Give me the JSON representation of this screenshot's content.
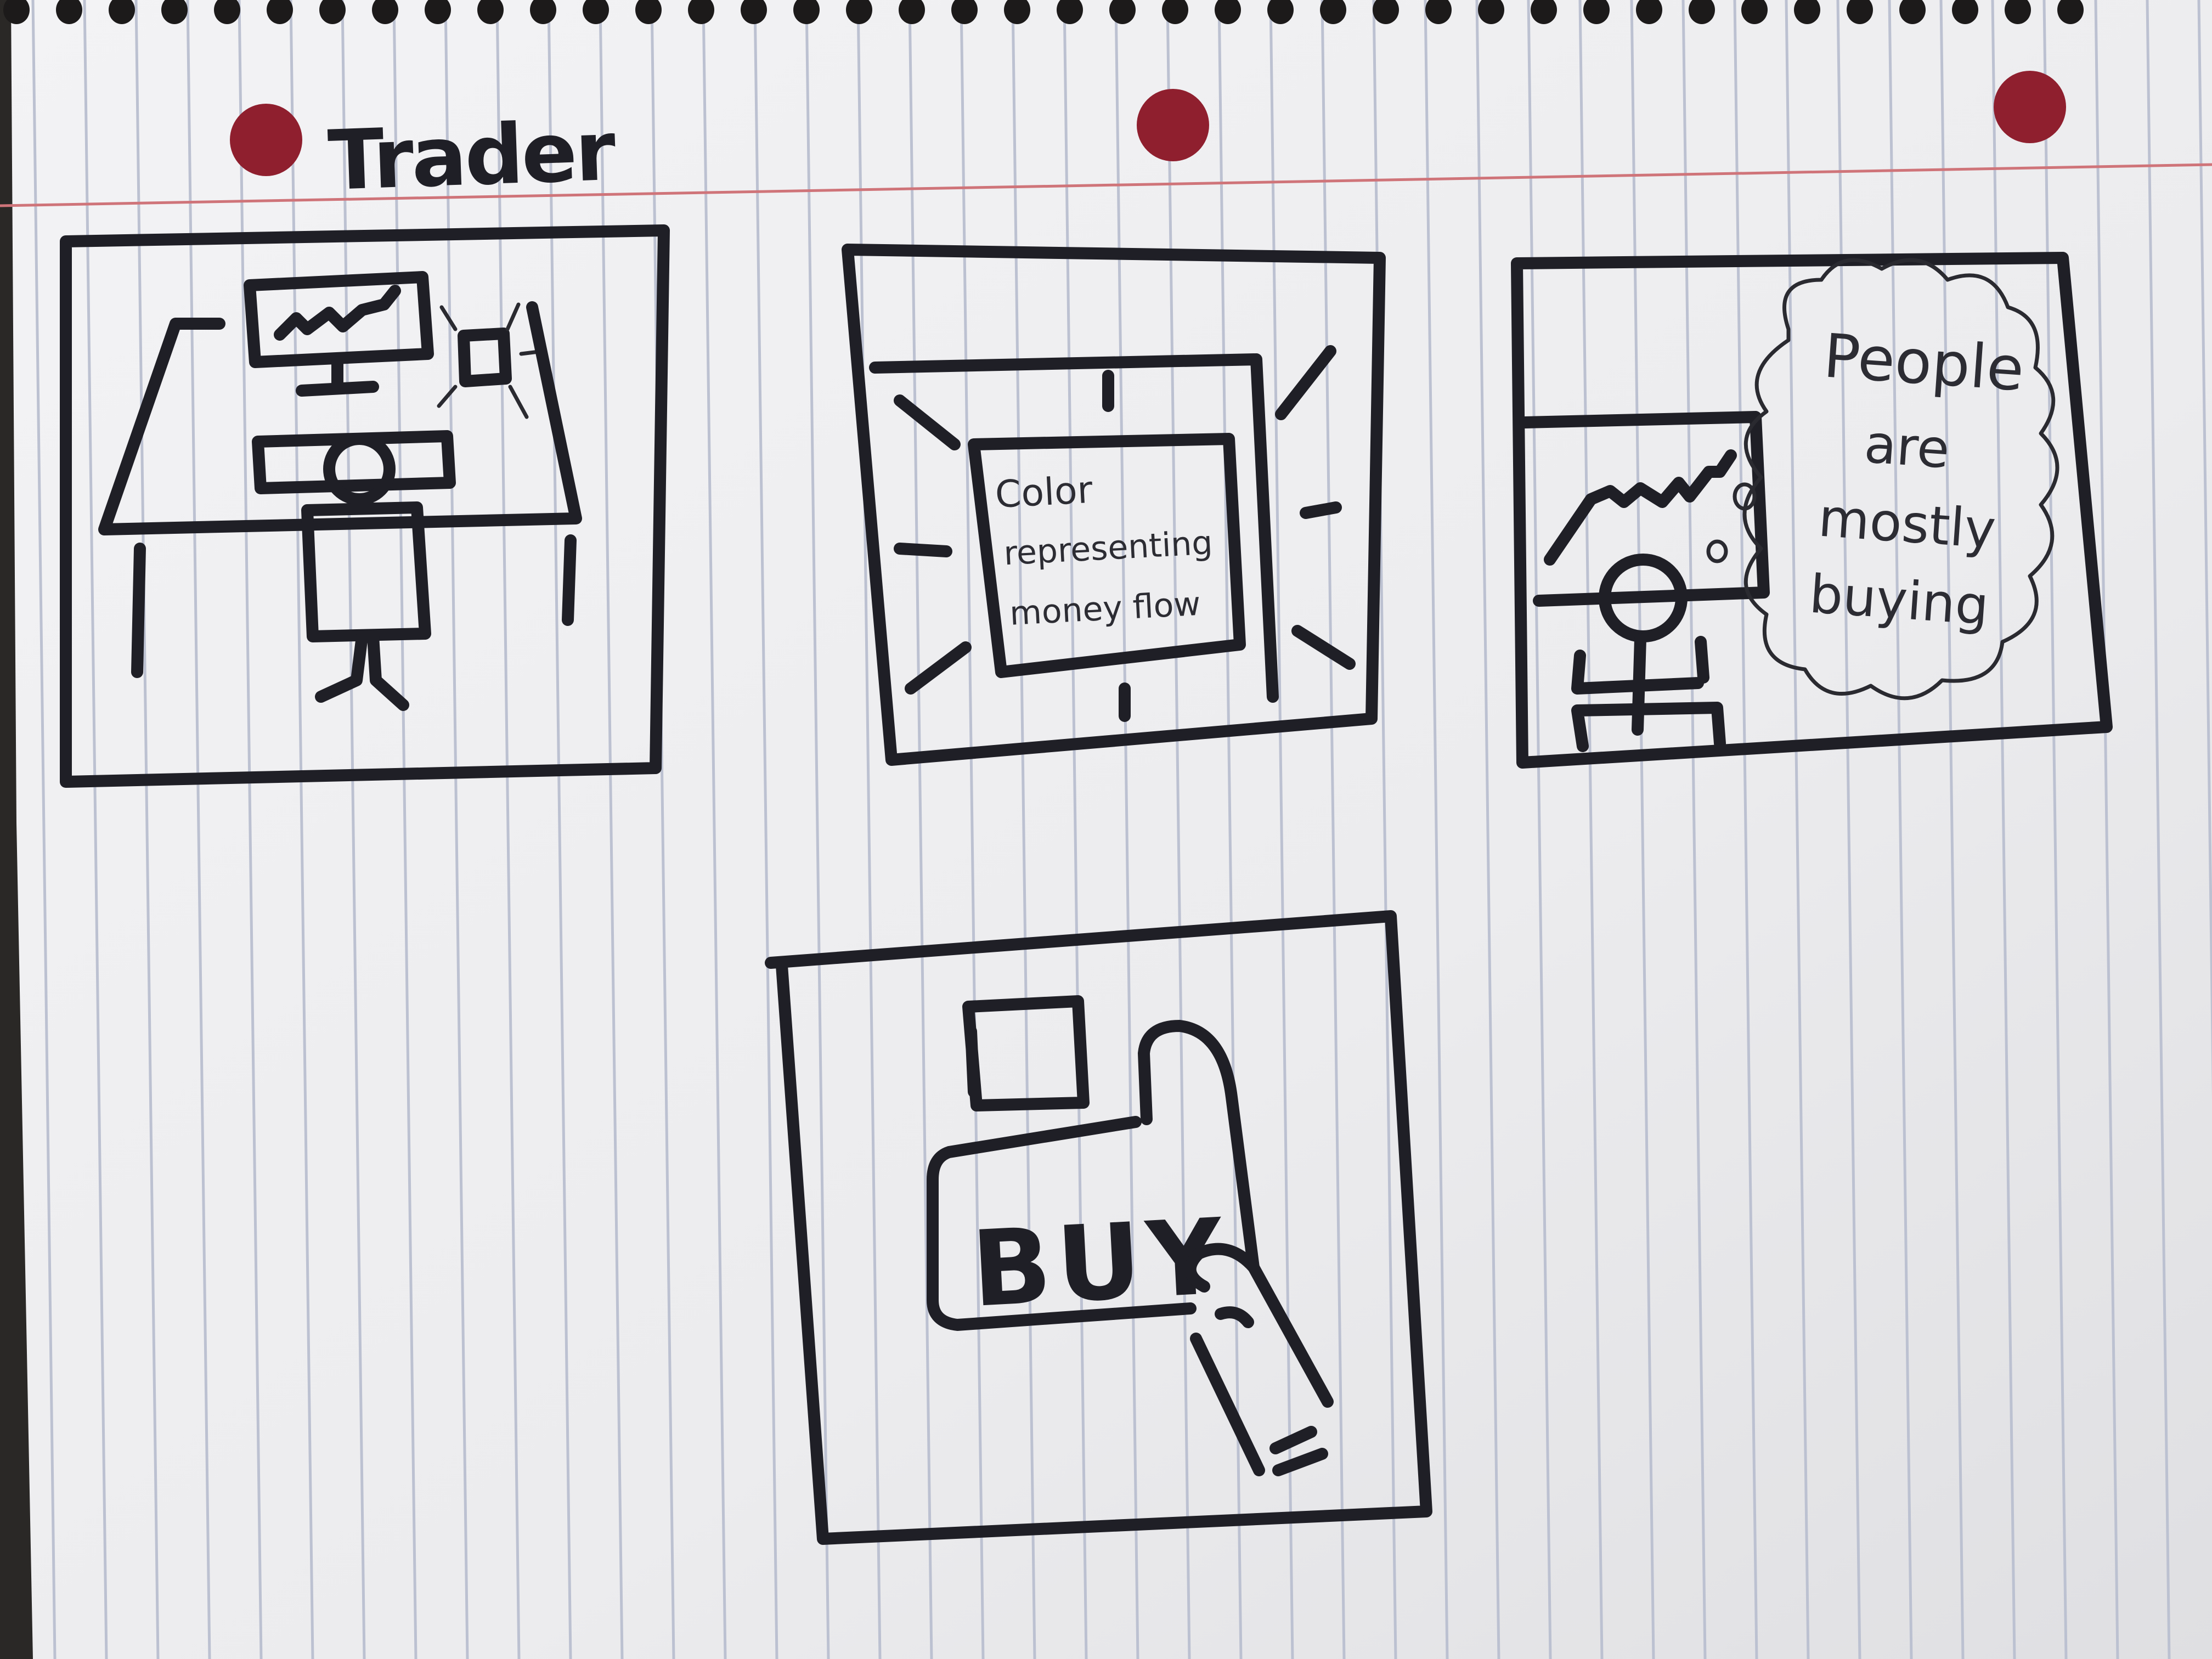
{
  "page": {
    "title": "Trader",
    "colors": {
      "paper": "#efeff1",
      "rule_lines": "#b9bfd0",
      "margin_line": "#cc6f74",
      "holes": "#8f1f2e",
      "ink": "#1f1f26"
    }
  },
  "panels": [
    {
      "id": "panel-1",
      "caption": ""
    },
    {
      "id": "panel-2",
      "caption": "Color\nrepresenting\nmoney flow",
      "lines": [
        "Color",
        "representing",
        "money flow"
      ]
    },
    {
      "id": "panel-3",
      "caption": "People are mostly buying",
      "lines": [
        "People",
        "are",
        "mostly",
        "buying"
      ]
    },
    {
      "id": "panel-4",
      "button_label": "BUY"
    }
  ]
}
